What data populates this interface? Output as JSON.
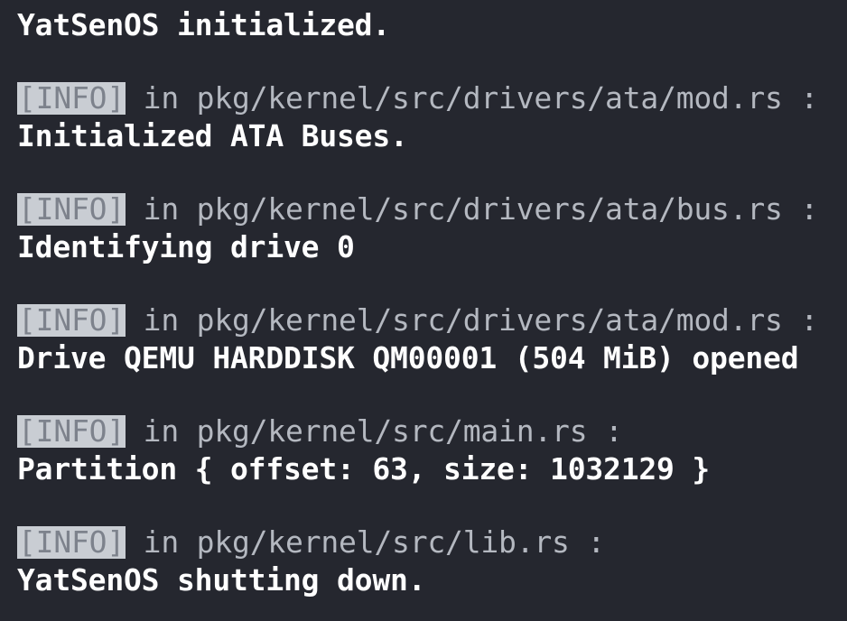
{
  "window": {
    "theme_background": "#25272f",
    "text_color": "#f3f3f3",
    "tag_background": "#c9cdd3",
    "tag_text_color": "#7d828c",
    "location_text_color": "#b4b8c0"
  },
  "log": {
    "boot_message": "YatSenOS initialized.",
    "entries": [
      {
        "level_tag": "[INFO]",
        "location": " in pkg/kernel/src/drivers/ata/mod.rs :",
        "message": "Initialized ATA Buses."
      },
      {
        "level_tag": "[INFO]",
        "location": " in pkg/kernel/src/drivers/ata/bus.rs :",
        "message": "Identifying drive 0"
      },
      {
        "level_tag": "[INFO]",
        "location": " in pkg/kernel/src/drivers/ata/mod.rs :",
        "message": "Drive QEMU HARDDISK QM00001 (504 MiB) opened"
      },
      {
        "level_tag": "[INFO]",
        "location": " in pkg/kernel/src/main.rs :",
        "message": "Partition { offset: 63, size: 1032129 }"
      },
      {
        "level_tag": "[INFO]",
        "location": " in pkg/kernel/src/lib.rs :",
        "message": "YatSenOS shutting down."
      }
    ]
  }
}
